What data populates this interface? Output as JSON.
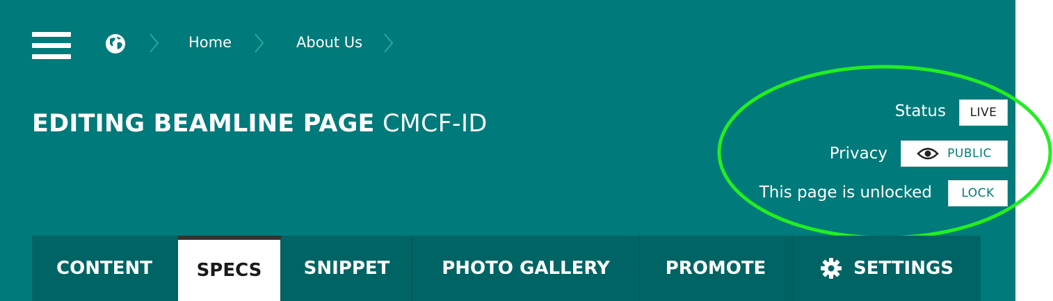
{
  "nav": {
    "menu_icon": "hamburger-icon",
    "home_icon": "globe-icon",
    "breadcrumbs": [
      "Home",
      "About Us"
    ],
    "separator_icon": "chevron-right-icon"
  },
  "page": {
    "title_prefix": "EDITING BEAMLINE PAGE",
    "title_name": "CMCF-ID"
  },
  "meta": {
    "status_label": "Status",
    "status_value": "LIVE",
    "privacy_label": "Privacy",
    "privacy_value": "PUBLIC",
    "privacy_icon": "eye-icon",
    "lock_label": "This page is unlocked",
    "lock_button": "LOCK"
  },
  "tabs": [
    {
      "label": "CONTENT",
      "active": false
    },
    {
      "label": "SPECS",
      "active": true
    },
    {
      "label": "SNIPPET",
      "active": false
    },
    {
      "label": "PHOTO GALLERY",
      "active": false
    },
    {
      "label": "PROMOTE",
      "active": false
    },
    {
      "label": "SETTINGS",
      "active": false,
      "icon": "gear-icon"
    }
  ],
  "colors": {
    "header_bg": "#007a7a",
    "tabbar_bg": "#006464",
    "active_tab_bg": "#ffffff",
    "active_tab_top_border": "#333333",
    "highlight_ellipse": "#22ee22",
    "button_text": "#007a7a"
  }
}
